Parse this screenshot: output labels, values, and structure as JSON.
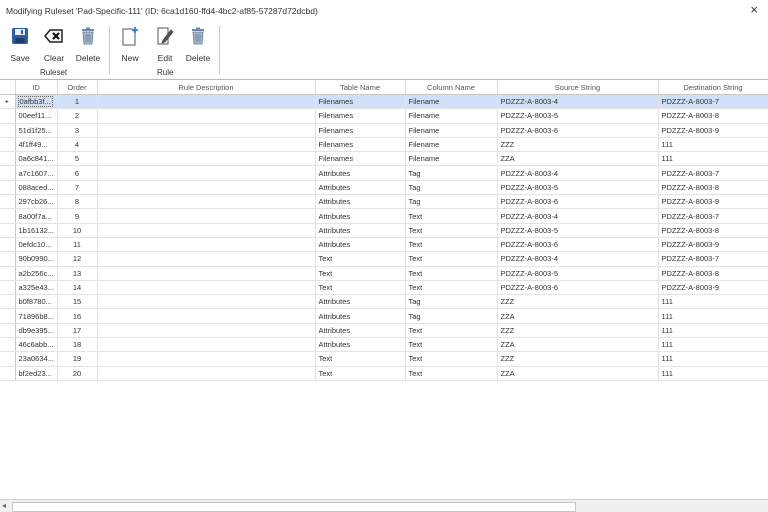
{
  "window": {
    "title": "Modifying Ruleset 'Pad-Specific-111' (ID: 6ca1d160-ffd4-4bc2-af85-57287d72dcbd)",
    "close_glyph": "×"
  },
  "toolbar": {
    "ruleset_group": "Ruleset",
    "rule_group": "Rule",
    "save_label": "Save",
    "clear_label": "Clear",
    "delete_ruleset_label": "Delete",
    "new_label": "New",
    "edit_label": "Edit",
    "delete_rule_label": "Delete"
  },
  "grid": {
    "columns": [
      "ID",
      "Order",
      "Rule Description",
      "Table Name",
      "Column Name",
      "Source String",
      "Destination String"
    ],
    "selected_row": 0,
    "row_indicator": "▸",
    "rows": [
      {
        "id": "0afbb3f...",
        "order": "1",
        "desc": "",
        "table": "Filenames",
        "column": "Filename",
        "source": "PDZZZ-A-8003-4",
        "dest": "PDZZZ-A-8003-7"
      },
      {
        "id": "00eef11...",
        "order": "2",
        "desc": "",
        "table": "Filenames",
        "column": "Filename",
        "source": "PDZZZ-A-8003-5",
        "dest": "PDZZZ-A-8003-8"
      },
      {
        "id": "51d1f25...",
        "order": "3",
        "desc": "",
        "table": "Filenames",
        "column": "Filename",
        "source": "PDZZZ-A-8003-6",
        "dest": "PDZZZ-A-8003-9"
      },
      {
        "id": "4f1ff49...",
        "order": "4",
        "desc": "",
        "table": "Filenames",
        "column": "Filename",
        "source": "ZZZ",
        "dest": "111"
      },
      {
        "id": "0a6c841...",
        "order": "5",
        "desc": "",
        "table": "Filenames",
        "column": "Filename",
        "source": "ZZA",
        "dest": "111"
      },
      {
        "id": "a7c1607...",
        "order": "6",
        "desc": "",
        "table": "Attributes",
        "column": "Tag",
        "source": "PDZZZ-A-8003-4",
        "dest": "PDZZZ-A-8003-7"
      },
      {
        "id": "088aced...",
        "order": "7",
        "desc": "",
        "table": "Attributes",
        "column": "Tag",
        "source": "PDZZZ-A-8003-5",
        "dest": "PDZZZ-A-8003-8"
      },
      {
        "id": "297cb26...",
        "order": "8",
        "desc": "",
        "table": "Attributes",
        "column": "Tag",
        "source": "PDZZZ-A-8003-6",
        "dest": "PDZZZ-A-8003-9"
      },
      {
        "id": "8a00f7a...",
        "order": "9",
        "desc": "",
        "table": "Attributes",
        "column": "Text",
        "source": "PDZZZ-A-8003-4",
        "dest": "PDZZZ-A-8003-7"
      },
      {
        "id": "1b16132...",
        "order": "10",
        "desc": "",
        "table": "Attributes",
        "column": "Text",
        "source": "PDZZZ-A-8003-5",
        "dest": "PDZZZ-A-8003-8"
      },
      {
        "id": "0efdc10...",
        "order": "11",
        "desc": "",
        "table": "Attributes",
        "column": "Text",
        "source": "PDZZZ-A-8003-6",
        "dest": "PDZZZ-A-8003-9"
      },
      {
        "id": "90b0990...",
        "order": "12",
        "desc": "",
        "table": "Text",
        "column": "Text",
        "source": "PDZZZ-A-8003-4",
        "dest": "PDZZZ-A-8003-7"
      },
      {
        "id": "a2b256c...",
        "order": "13",
        "desc": "",
        "table": "Text",
        "column": "Text",
        "source": "PDZZZ-A-8003-5",
        "dest": "PDZZZ-A-8003-8"
      },
      {
        "id": "a325e43...",
        "order": "14",
        "desc": "",
        "table": "Text",
        "column": "Text",
        "source": "PDZZZ-A-8003-6",
        "dest": "PDZZZ-A-8003-9"
      },
      {
        "id": "b0f8780...",
        "order": "15",
        "desc": "",
        "table": "Attributes",
        "column": "Tag",
        "source": "ZZZ",
        "dest": "111"
      },
      {
        "id": "71896b8...",
        "order": "16",
        "desc": "",
        "table": "Attributes",
        "column": "Tag",
        "source": "ZZA",
        "dest": "111"
      },
      {
        "id": "db9e395...",
        "order": "17",
        "desc": "",
        "table": "Attributes",
        "column": "Text",
        "source": "ZZZ",
        "dest": "111"
      },
      {
        "id": "46c6abb...",
        "order": "18",
        "desc": "",
        "table": "Attributes",
        "column": "Text",
        "source": "ZZA",
        "dest": "111"
      },
      {
        "id": "23a0634...",
        "order": "19",
        "desc": "",
        "table": "Text",
        "column": "Text",
        "source": "ZZZ",
        "dest": "111"
      },
      {
        "id": "bf2ed23...",
        "order": "20",
        "desc": "",
        "table": "Text",
        "column": "Text",
        "source": "ZZA",
        "dest": "111"
      }
    ]
  },
  "scrollbar": {
    "left_arrow": "◂"
  }
}
